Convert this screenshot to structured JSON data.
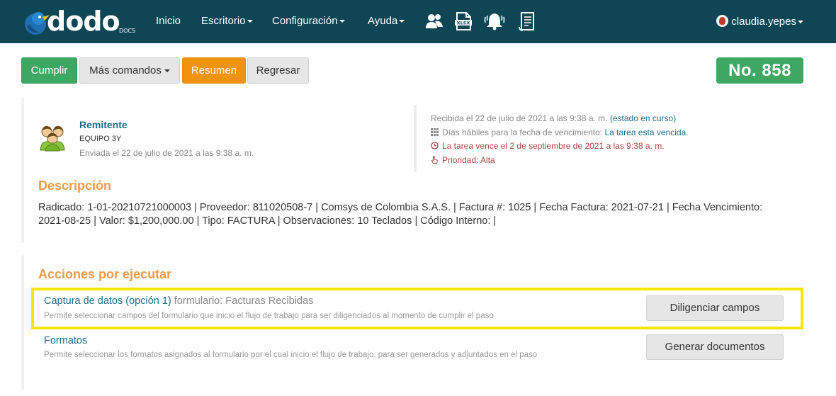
{
  "navbar": {
    "logo_text": "dodo",
    "logo_sub": "DOCS",
    "items": [
      {
        "label": "Inicio"
      },
      {
        "label": "Escritorio"
      },
      {
        "label": "Configuración"
      },
      {
        "label": "Ayuda"
      }
    ],
    "icons": [
      "users-icon",
      "xlsx-file-icon",
      "bell-icon",
      "document-list-icon"
    ],
    "user": "claudia.yepes"
  },
  "toolbar": {
    "cumplir_label": "Cumplir",
    "mas_comandos_label": "Más comandos",
    "resumen_label": "Resumen",
    "regresar_label": "Regresar",
    "number": "No. 858"
  },
  "sender": {
    "title": "Remitente",
    "team": "EQUIPO 3Y",
    "sent": "Enviada el 22 de julio de 2021 a las 9:38 a. m."
  },
  "meta": {
    "received": "Recibida el 22 de julio de 2021 a las 9:38 a. m.",
    "status": "(estado en curso)",
    "business_days_label": "Días hábiles para la fecha de vencimiento:",
    "business_days_value": "La tarea esta vencida.",
    "due": "La tarea vence el 2 de septiembre de 2021 a las 9:38 a. m.",
    "priority": "Prioridad: Alta"
  },
  "descripcion": {
    "title": "Descripción",
    "text": "Radicado: 1-01-20210721000003 | Proveedor: 811020508-7 | Comsys de Colombia S.A.S. | Factura #: 1025 | Fecha Factura: 2021-07-21 | Fecha Vencimiento: 2021-08-25 | Valor: $1,200,000.00 | Tipo: FACTURA | Observaciones: 10 Teclados | Código Interno: |"
  },
  "acciones": {
    "title": "Acciones por ejecutar",
    "items": [
      {
        "title": "Captura de datos (opción 1)",
        "subtitle": "formulario: Facturas Recibidas",
        "desc": "Permite seleccionar campos del formulario que inicio el flujo de trabajo para ser diligenciados al momento de cumplir el paso",
        "button": "Diligenciar campos"
      },
      {
        "title": "Formatos",
        "subtitle": "",
        "desc": "Permite seleccionar los formatos asignados al formulario por el cual inicio el flujo de trabajo, para ser generados y adjuntados en el paso",
        "button": "Generar documentos"
      }
    ]
  },
  "colors": {
    "navbar": "#0f4656",
    "green": "#3ea863",
    "orange": "#f0930e",
    "section_title": "#ee9b4a",
    "link": "#1a6d8a",
    "highlight": "#f7e600"
  }
}
